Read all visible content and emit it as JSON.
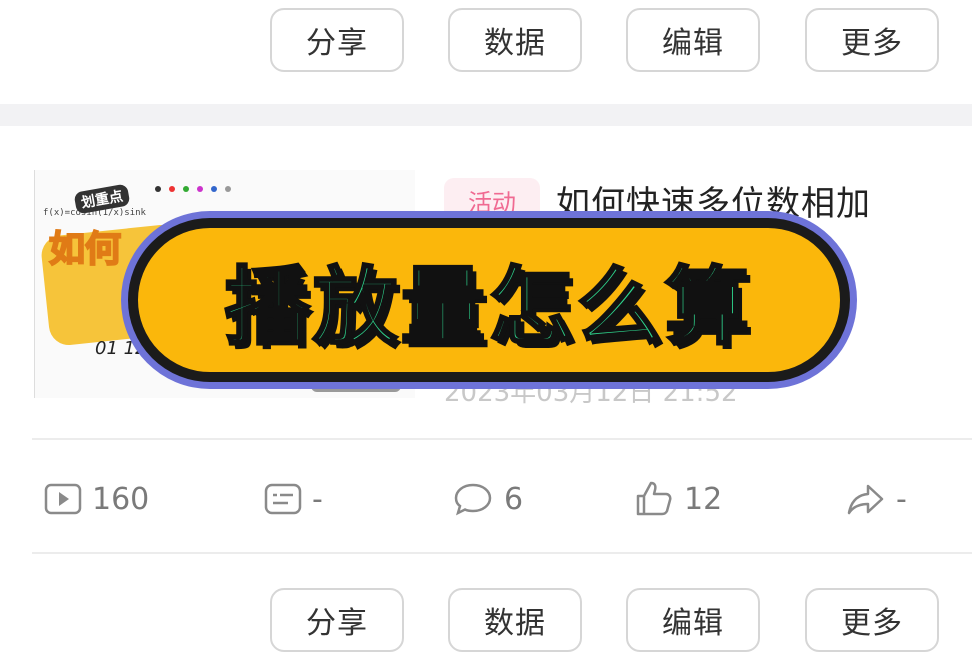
{
  "top_actions": [
    "分享",
    "数据",
    "编辑",
    "更多"
  ],
  "video": {
    "tag": "活动",
    "title": "如何快速多位数相加",
    "date": "2023年03月12日 21:52",
    "thumbnail": {
      "sticker_text": "如何",
      "sticker_tag": "划重点",
      "formula": "f(x)=cosin(1/x)sink",
      "handwriting": "01 12"
    }
  },
  "banner": {
    "text": "播放量怎么算",
    "fill": "#fbb70b",
    "text_color": "#2ed38c",
    "outline": "#6e73d8"
  },
  "stats": {
    "plays": "160",
    "danmaku": "-",
    "comments": "6",
    "likes": "12",
    "shares": "-"
  },
  "bottom_actions": [
    "分享",
    "数据",
    "编辑",
    "更多"
  ]
}
